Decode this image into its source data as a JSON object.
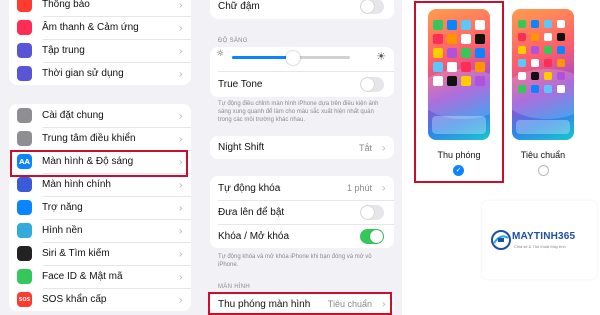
{
  "left_panel": {
    "group1": [
      {
        "label": "Thông báo",
        "icon": "bell-icon",
        "color": "#ff3b30"
      },
      {
        "label": "Âm thanh & Cảm ứng",
        "icon": "speaker-icon",
        "color": "#ff2d55"
      },
      {
        "label": "Tập trung",
        "icon": "moon-icon",
        "color": "#5856d6"
      },
      {
        "label": "Thời gian sử dụng",
        "icon": "hourglass-icon",
        "color": "#5856d6"
      }
    ],
    "group2": [
      {
        "label": "Cài đặt chung",
        "icon": "gear-icon",
        "color": "#8e8e93"
      },
      {
        "label": "Trung tâm điều khiển",
        "icon": "control-center-icon",
        "color": "#8e8e93"
      },
      {
        "label": "Màn hình & Độ sáng",
        "icon": "display-icon",
        "color": "#0a84ff",
        "glyph": "AA"
      },
      {
        "label": "Màn hình chính",
        "icon": "home-screen-icon",
        "color": "#3a5bd9"
      },
      {
        "label": "Trợ năng",
        "icon": "accessibility-icon",
        "color": "#0a84ff"
      },
      {
        "label": "Hình nền",
        "icon": "wallpaper-icon",
        "color": "#34aadc"
      },
      {
        "label": "Siri & Tìm kiếm",
        "icon": "siri-icon",
        "color": "#222222"
      },
      {
        "label": "Face ID & Mật mã",
        "icon": "face-id-icon",
        "color": "#34c759"
      },
      {
        "label": "SOS khẩn cấp",
        "icon": "sos-icon",
        "color": "#ff3b30",
        "glyph": "SOS"
      }
    ]
  },
  "middle_panel": {
    "bold_text": "Chữ đậm",
    "brightness_header": "ĐỘ SÁNG",
    "brightness_value": 0.52,
    "true_tone": "True Tone",
    "true_tone_footnote": "Tự động điều chỉnh màn hình iPhone dựa trên điều kiện ánh sáng xung quanh để làm cho màu sắc xuất hiện nhất quán trong các môi trường khác nhau.",
    "night_shift": {
      "label": "Night Shift",
      "value": "Tắt"
    },
    "auto_lock": {
      "label": "Tự động khóa",
      "value": "1 phút"
    },
    "raise_to_wake": "Đưa lên để bật",
    "lock_unlock": "Khóa / Mở khóa",
    "lock_footnote": "Tự động khóa và mở khóa iPhone khi bạn đóng và mở vỏ iPhone.",
    "display_header": "MÀN HÌNH",
    "zoom": {
      "label": "Thu phóng màn hình",
      "value": "Tiêu chuẩn"
    }
  },
  "right_panel": {
    "zoomed_label": "Thu phóng",
    "standard_label": "Tiêu chuẩn",
    "selected": "zoomed"
  },
  "watermark": {
    "brand": "MAYTINH365",
    "tagline": "Chia sẻ & Thủ thuật Máy tính"
  }
}
